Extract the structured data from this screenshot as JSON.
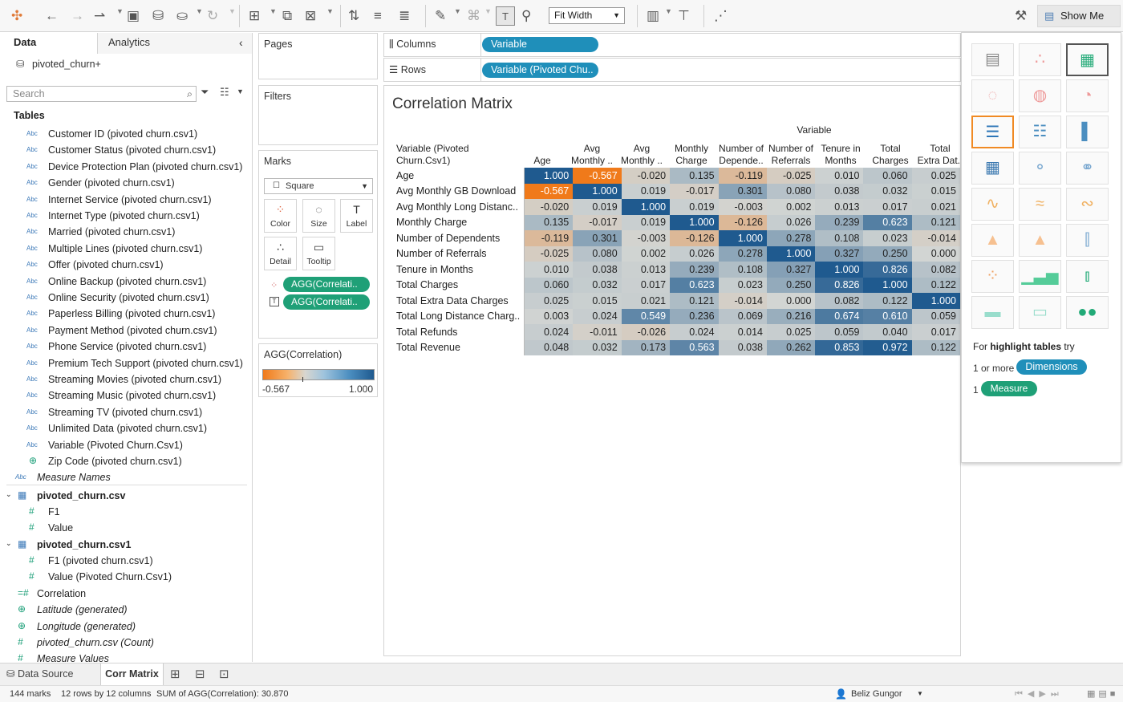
{
  "toolbar": {
    "fit": "Fit Width",
    "show_me": "Show Me"
  },
  "left": {
    "tab_data": "Data",
    "tab_analytics": "Analytics",
    "datasource": "pivoted_churn+",
    "search_placeholder": "Search",
    "tables_title": "Tables",
    "fields": [
      "Customer ID (pivoted churn.csv1)",
      "Customer Status (pivoted churn.csv1)",
      "Device Protection Plan (pivoted churn.csv1)",
      "Gender (pivoted churn.csv1)",
      "Internet Service (pivoted churn.csv1)",
      "Internet Type (pivoted churn.csv1)",
      "Married (pivoted churn.csv1)",
      "Multiple Lines (pivoted churn.csv1)",
      "Offer (pivoted churn.csv1)",
      "Online Backup (pivoted churn.csv1)",
      "Online Security (pivoted churn.csv1)",
      "Paperless Billing (pivoted churn.csv1)",
      "Payment Method (pivoted churn.csv1)",
      "Phone Service (pivoted churn.csv1)",
      "Premium Tech Support (pivoted churn.csv1)",
      "Streaming Movies (pivoted churn.csv1)",
      "Streaming Music (pivoted churn.csv1)",
      "Streaming TV (pivoted churn.csv1)",
      "Unlimited Data (pivoted churn.csv1)",
      "Variable (Pivoted Churn.Csv1)",
      "Zip Code (pivoted churn.csv1)"
    ],
    "measure_names": "Measure Names",
    "t1": "pivoted_churn.csv",
    "t1_f1": "F1",
    "t1_f2": "Value",
    "t2": "pivoted_churn.csv1",
    "t2_f1": "F1 (pivoted churn.csv1)",
    "t2_f2": "Value (Pivoted Churn.Csv1)",
    "corr": "Correlation",
    "lat": "Latitude (generated)",
    "lon": "Longitude (generated)",
    "count": "pivoted_churn.csv (Count)",
    "mv": "Measure Values"
  },
  "shelves": {
    "pages": "Pages",
    "filters": "Filters",
    "marks": "Marks",
    "mark_type": "Square",
    "color": "Color",
    "size": "Size",
    "label": "Label",
    "detail": "Detail",
    "tooltip": "Tooltip",
    "pill1": "AGG(Correlati..",
    "pill2": "AGG(Correlati..",
    "legend_title": "AGG(Correlation)",
    "legend_min": "-0.567",
    "legend_max": "1.000",
    "columns": "Columns",
    "rows": "Rows",
    "col_pill": "Variable",
    "row_pill": "Variable (Pivoted Chu.."
  },
  "view": {
    "title": "Correlation Matrix",
    "col_header": "Variable",
    "row_header_1": "Variable (Pivoted",
    "row_header_2": "Churn.Csv1)",
    "columns": [
      [
        "",
        "Age"
      ],
      [
        "Avg",
        "Monthly .."
      ],
      [
        "Avg",
        "Monthly .."
      ],
      [
        "Monthly",
        "Charge"
      ],
      [
        "Number of",
        "Depende.."
      ],
      [
        "Number of",
        "Referrals"
      ],
      [
        "Tenure in",
        "Months"
      ],
      [
        "Total",
        "Charges"
      ],
      [
        "Total",
        "Extra Dat.."
      ]
    ],
    "rows": [
      {
        "label": "Age",
        "values": [
          "1.000",
          "-0.567",
          "-0.020",
          "0.135",
          "-0.119",
          "-0.025",
          "0.010",
          "0.060",
          "0.025"
        ]
      },
      {
        "label": "Avg Monthly GB Download",
        "values": [
          "-0.567",
          "1.000",
          "0.019",
          "-0.017",
          "0.301",
          "0.080",
          "0.038",
          "0.032",
          "0.015"
        ]
      },
      {
        "label": "Avg Monthly Long Distanc..",
        "values": [
          "-0.020",
          "0.019",
          "1.000",
          "0.019",
          "-0.003",
          "0.002",
          "0.013",
          "0.017",
          "0.021"
        ]
      },
      {
        "label": "Monthly Charge",
        "values": [
          "0.135",
          "-0.017",
          "0.019",
          "1.000",
          "-0.126",
          "0.026",
          "0.239",
          "0.623",
          "0.121"
        ]
      },
      {
        "label": "Number of Dependents",
        "values": [
          "-0.119",
          "0.301",
          "-0.003",
          "-0.126",
          "1.000",
          "0.278",
          "0.108",
          "0.023",
          "-0.014"
        ]
      },
      {
        "label": "Number of Referrals",
        "values": [
          "-0.025",
          "0.080",
          "0.002",
          "0.026",
          "0.278",
          "1.000",
          "0.327",
          "0.250",
          "0.000"
        ]
      },
      {
        "label": "Tenure in Months",
        "values": [
          "0.010",
          "0.038",
          "0.013",
          "0.239",
          "0.108",
          "0.327",
          "1.000",
          "0.826",
          "0.082"
        ]
      },
      {
        "label": "Total Charges",
        "values": [
          "0.060",
          "0.032",
          "0.017",
          "0.623",
          "0.023",
          "0.250",
          "0.826",
          "1.000",
          "0.122"
        ]
      },
      {
        "label": "Total Extra Data Charges",
        "values": [
          "0.025",
          "0.015",
          "0.021",
          "0.121",
          "-0.014",
          "0.000",
          "0.082",
          "0.122",
          "1.000"
        ]
      },
      {
        "label": "Total Long Distance Charg..",
        "values": [
          "0.003",
          "0.024",
          "0.549",
          "0.236",
          "0.069",
          "0.216",
          "0.674",
          "0.610",
          "0.059"
        ]
      },
      {
        "label": "Total Refunds",
        "values": [
          "0.024",
          "-0.011",
          "-0.026",
          "0.024",
          "0.014",
          "0.025",
          "0.059",
          "0.040",
          "0.017"
        ]
      },
      {
        "label": "Total Revenue",
        "values": [
          "0.048",
          "0.032",
          "0.173",
          "0.563",
          "0.038",
          "0.262",
          "0.853",
          "0.972",
          "0.122"
        ]
      }
    ]
  },
  "showme": {
    "hint_pre": "For ",
    "hint_bold": "highlight tables",
    "hint_post": " try",
    "req1_pre": "1 or more",
    "req1_pill": "Dimensions",
    "req2_pre": "1",
    "req2_pill": "Measure"
  },
  "bottom": {
    "data_source": "Data Source",
    "sheet": "Corr Matrix"
  },
  "status": {
    "marks": "144 marks",
    "dims": "12 rows by 12 columns",
    "sum": "SUM of AGG(Correlation): 30.870",
    "user": "Beliz Gungor"
  },
  "colors": {
    "orange": "#f07a1a",
    "blue": "#1f5a8f",
    "mid": "#d2d5d3"
  }
}
